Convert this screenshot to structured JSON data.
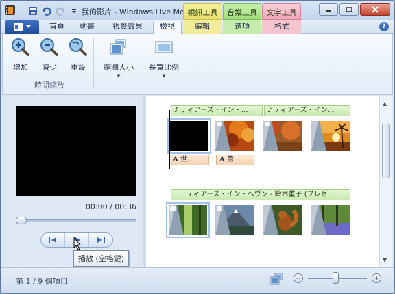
{
  "title_bar": {
    "title": "我的影片 - Windows Live Mo...",
    "context_tabs": {
      "video_tools": "視訊工具",
      "music_tools": "音樂工具",
      "text_tools": "文字工具"
    }
  },
  "tabs": [
    {
      "label": "首頁"
    },
    {
      "label": "動畫"
    },
    {
      "label": "視覺效果"
    },
    {
      "label": "檢視",
      "active": true
    },
    {
      "label": "編輯"
    },
    {
      "label": "選項"
    },
    {
      "label": "格式"
    }
  ],
  "ribbon": {
    "zoom_in": "增加",
    "zoom_out": "減少",
    "reset": "重設",
    "timeline_zoom_group": "時間縮放",
    "thumbnail_size": "縮圖大小",
    "aspect_ratio": "長寬比例"
  },
  "preview": {
    "time": "00:00 / 00:36",
    "tooltip": "播放 (空格鍵)"
  },
  "storyboard": {
    "music_1": "ティアーズ・イン・…",
    "music_2": "ティアーズ・イン…",
    "caption_1": "世…",
    "caption_2": "第…",
    "music_row2": "ティアーズ・イン・ヘヴン - 鈴木重子 (プレゼ…"
  },
  "status": {
    "item_count": "第 1 / 9 個項目",
    "zoom_out": "−",
    "zoom_in": "+"
  },
  "colors": {
    "accent": "#1f4f9e",
    "music_green": "#c9ebb0",
    "caption_orange": "#f6d2b2",
    "video_tools": "#e8e16c",
    "music_tools": "#9fdd7c",
    "text_tools": "#efa8b8"
  }
}
